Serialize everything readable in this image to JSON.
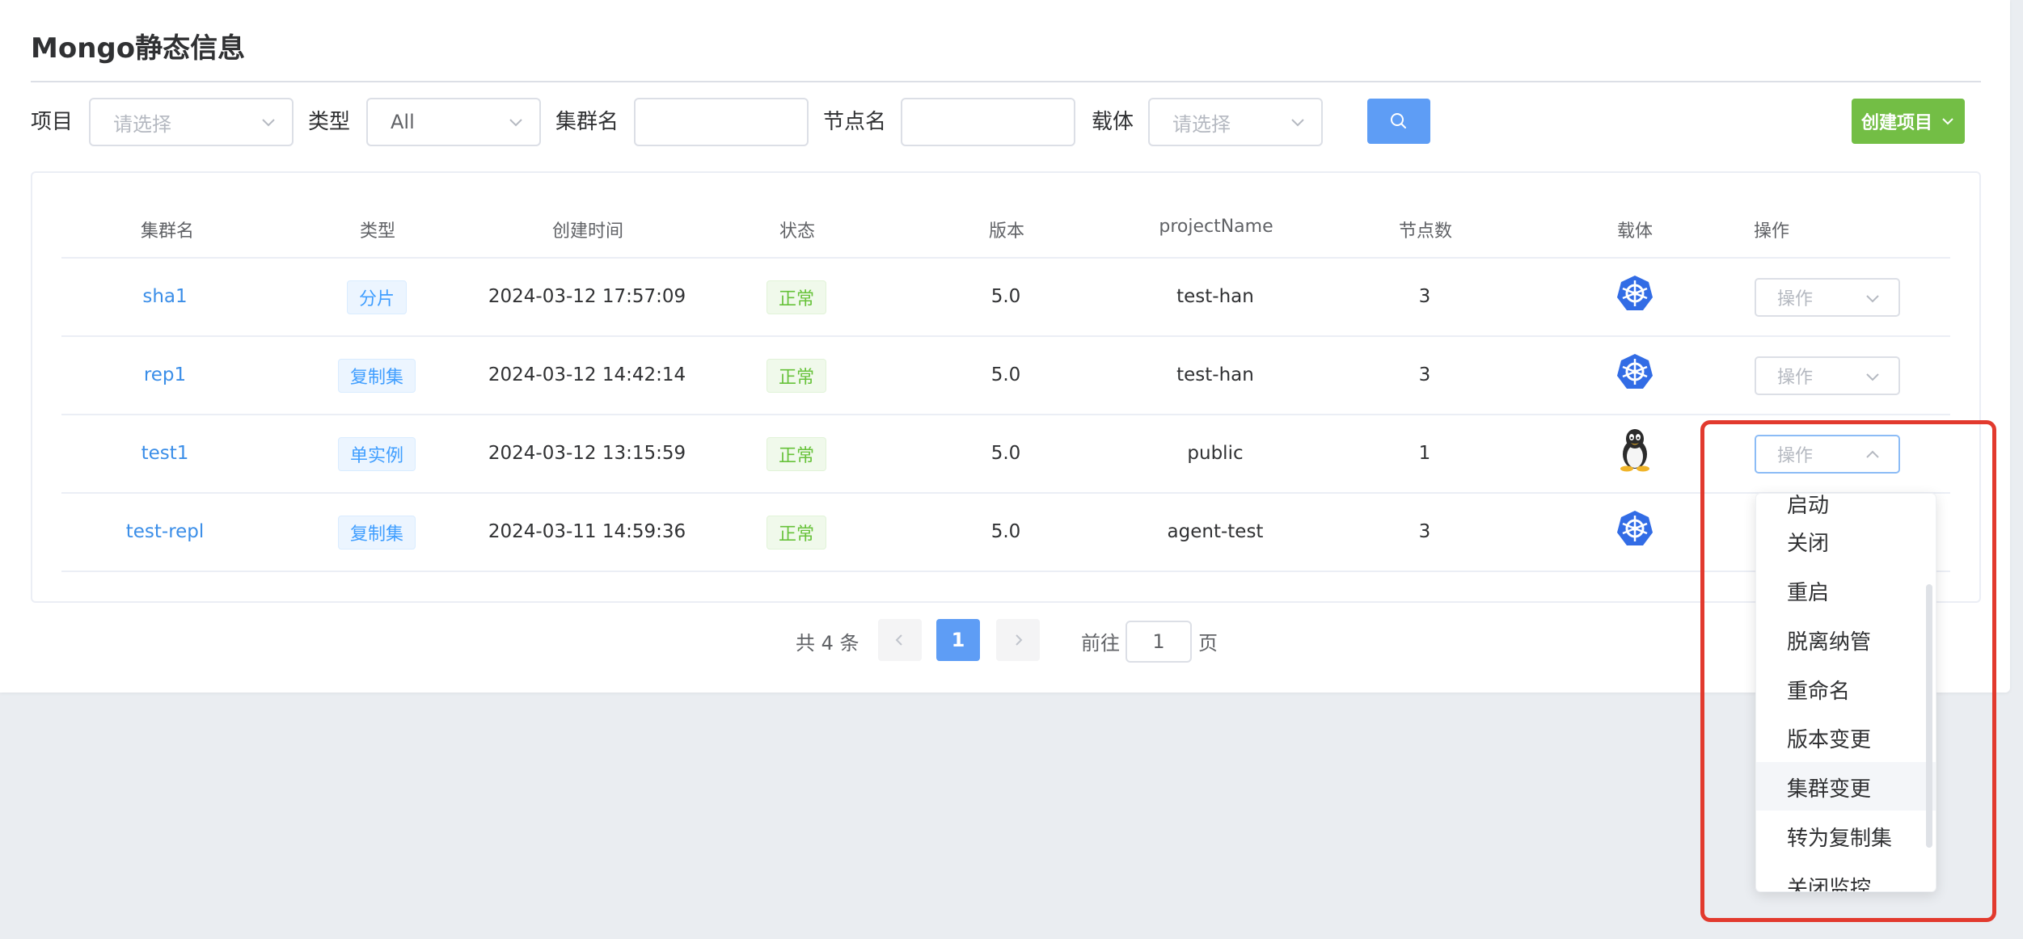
{
  "page": {
    "title": "Mongo静态信息"
  },
  "filters": {
    "project_label": "项目",
    "project_placeholder": "请选择",
    "type_label": "类型",
    "type_value": "All",
    "cluster_label": "集群名",
    "cluster_value": "",
    "node_label": "节点名",
    "node_value": "",
    "carrier_label": "载体",
    "carrier_placeholder": "请选择",
    "search_icon": "search-icon",
    "create_label": "创建项目"
  },
  "table": {
    "headers": [
      "集群名",
      "类型",
      "创建时间",
      "状态",
      "版本",
      "projectName",
      "节点数",
      "载体",
      "操作"
    ],
    "rows": [
      {
        "name": "sha1",
        "type": "分片",
        "created": "2024-03-12 17:57:09",
        "status": "正常",
        "version": "5.0",
        "project": "test-han",
        "nodes": "3",
        "carrier": "kubernetes-icon",
        "action": "操作"
      },
      {
        "name": "rep1",
        "type": "复制集",
        "created": "2024-03-12 14:42:14",
        "status": "正常",
        "version": "5.0",
        "project": "test-han",
        "nodes": "3",
        "carrier": "kubernetes-icon",
        "action": "操作"
      },
      {
        "name": "test1",
        "type": "单实例",
        "created": "2024-03-12 13:15:59",
        "status": "正常",
        "version": "5.0",
        "project": "public",
        "nodes": "1",
        "carrier": "linux-icon",
        "action": "操作"
      },
      {
        "name": "test-repl",
        "type": "复制集",
        "created": "2024-03-11 14:59:36",
        "status": "正常",
        "version": "5.0",
        "project": "agent-test",
        "nodes": "3",
        "carrier": "kubernetes-icon",
        "action": "操作"
      }
    ]
  },
  "pagination": {
    "total": "共 4 条",
    "current": "1",
    "goto_label": "前往",
    "goto_value": "1",
    "page_suffix": "页"
  },
  "dropdown": {
    "items": [
      "启动",
      "关闭",
      "重启",
      "脱离纳管",
      "重命名",
      "版本变更",
      "集群变更",
      "转为复制集",
      "关闭监控"
    ],
    "hovered": "集群变更"
  },
  "colors": {
    "primary": "#5e9df5",
    "create": "#73be45",
    "link": "#3b8ee8",
    "success": "#67c23a",
    "highlight": "#e23a2e"
  }
}
